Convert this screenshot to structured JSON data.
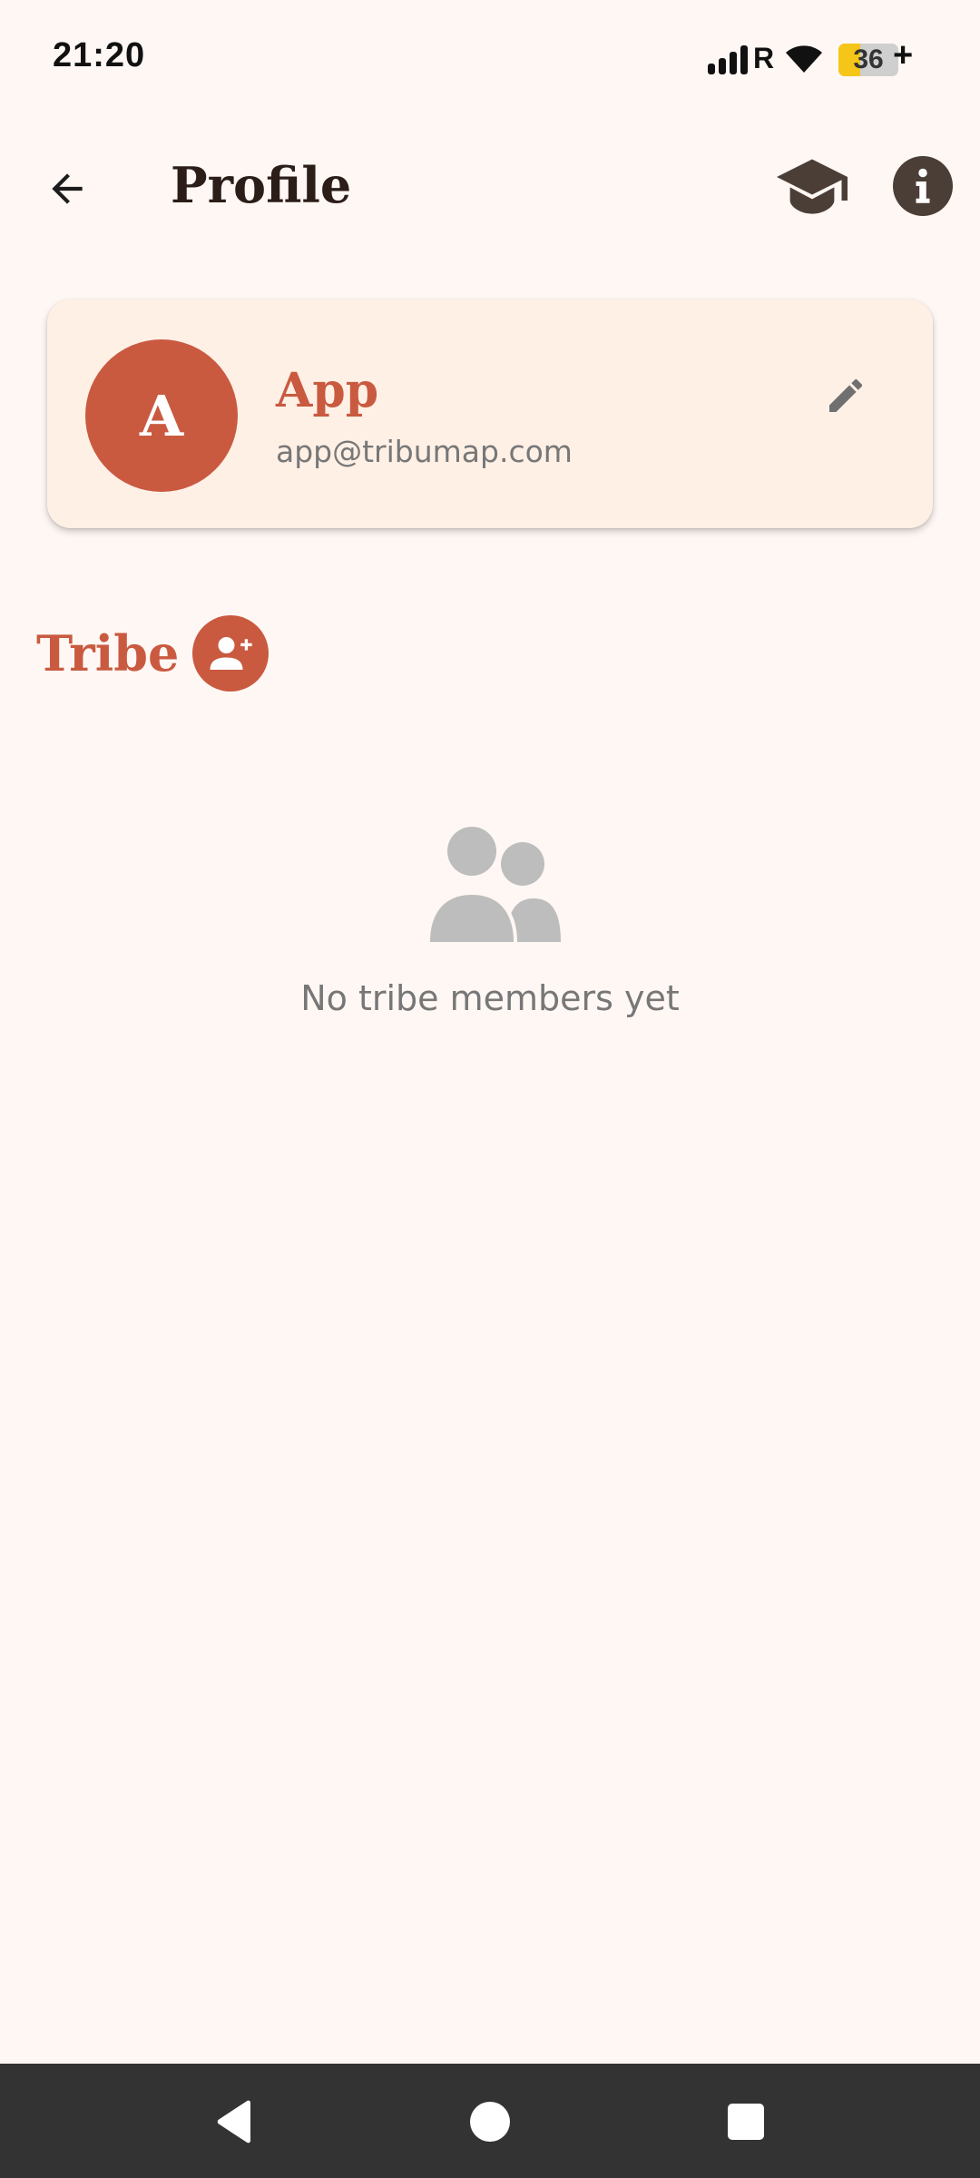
{
  "status_bar": {
    "time": "21:20",
    "network_label": "R",
    "battery_level": "36",
    "battery_fraction": 0.36,
    "charging_symbol": "+"
  },
  "app_bar": {
    "title": "Profile",
    "back_icon": "arrow-left-icon",
    "learn_icon": "graduation-cap-icon",
    "info_icon": "info-icon"
  },
  "profile": {
    "avatar_letter": "A",
    "name": "App",
    "email": "app@tribumap.com",
    "edit_icon": "pencil-icon"
  },
  "tribe": {
    "title": "Tribe",
    "add_icon": "add-person-icon",
    "empty_icon": "people-icon",
    "empty_message": "No tribe members yet"
  },
  "nav_bar": {
    "back_icon": "triangle-back-icon",
    "home_icon": "circle-home-icon",
    "recents_icon": "square-recents-icon"
  },
  "colors": {
    "background": "#fff7f4",
    "accent": "#c95a40",
    "card": "#fff0e6",
    "title_text": "#2b1d17",
    "secondary_text": "#777777",
    "nav_bar": "#333333"
  }
}
